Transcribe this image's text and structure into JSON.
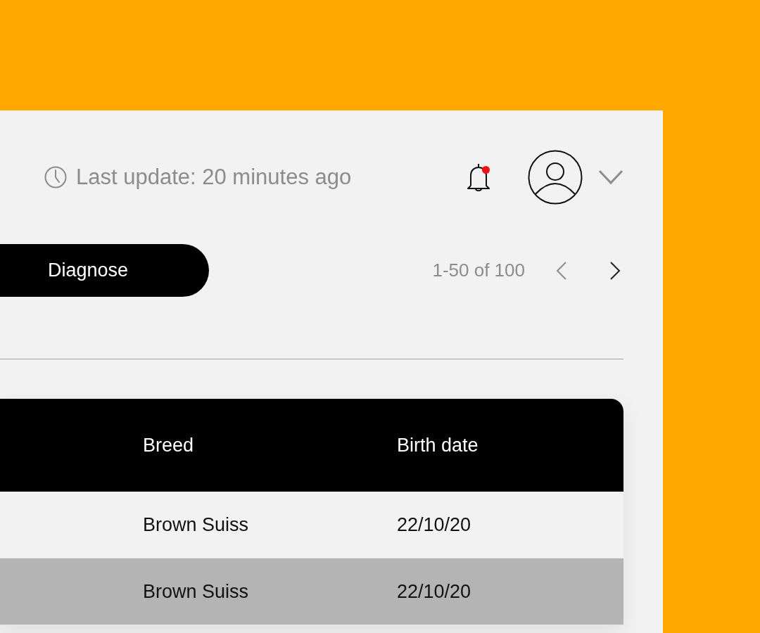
{
  "header": {
    "last_update": "Last update: 20 minutes ago",
    "notifications": {
      "unread": true
    }
  },
  "toolbar": {
    "button": "Diagnose",
    "pagination": {
      "range": "1-50 of 100",
      "prev_disabled": true,
      "next_disabled": false
    }
  },
  "table": {
    "columns": [
      "Breed",
      "Birth date"
    ],
    "rows": [
      {
        "cells": [
          "Brown Suiss",
          "22/10/20"
        ],
        "selected": false
      },
      {
        "cells": [
          "Brown Suiss",
          "22/10/20"
        ],
        "selected": true
      }
    ]
  }
}
